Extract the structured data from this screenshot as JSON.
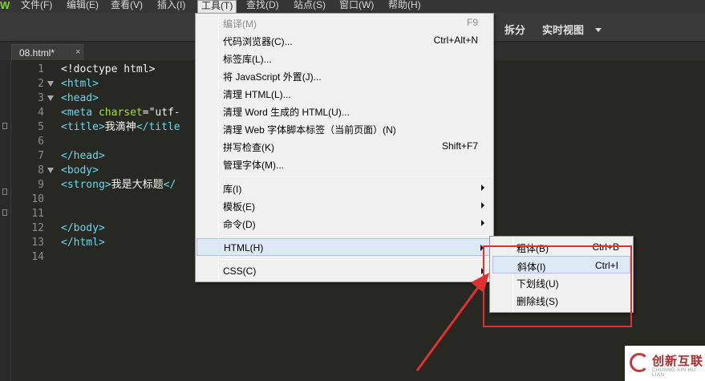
{
  "menubar": {
    "items": [
      {
        "label": "文件(F)"
      },
      {
        "label": "编辑(E)"
      },
      {
        "label": "查看(V)"
      },
      {
        "label": "插入(I)"
      },
      {
        "label": "工具(T)"
      },
      {
        "label": "查找(D)"
      },
      {
        "label": "站点(S)"
      },
      {
        "label": "窗口(W)"
      },
      {
        "label": "帮助(H)"
      }
    ]
  },
  "toolbar": {
    "split_label": "拆分",
    "live_view_label": "实时视图"
  },
  "tabs": [
    {
      "label": "08.html*",
      "close": "×"
    }
  ],
  "editor": {
    "line_numbers": [
      "1",
      "2",
      "3",
      "4",
      "5",
      "6",
      "7",
      "8",
      "9",
      "10",
      "11",
      "12",
      "13",
      "14"
    ],
    "lines": {
      "l1": "<!doctype html>",
      "l2": "<html>",
      "l3": "<head>",
      "l4_tag": "<meta",
      "l4_attr": " charset",
      "l4_rest": "=\"utf-",
      "l5_open": "<title>",
      "l5_text": "我滴神",
      "l5_close": "</title",
      "l7": "</head>",
      "l8": "<body>",
      "l9_open": "<strong>",
      "l9_text": "我是大标题",
      "l9_close": "</",
      "l12": "</body>",
      "l13": "</html>"
    }
  },
  "tools_menu": {
    "items": [
      {
        "label": "编译(M)",
        "shortcut": "F9",
        "disabled": true
      },
      {
        "label": "代码浏览器(C)...",
        "shortcut": "Ctrl+Alt+N"
      },
      {
        "label": "标签库(L)...",
        "shortcut": ""
      },
      {
        "label": "将 JavaScript 外置(J)...",
        "shortcut": ""
      },
      {
        "label": "清理 HTML(L)...",
        "shortcut": ""
      },
      {
        "label": "清理 Word 生成的 HTML(U)...",
        "shortcut": ""
      },
      {
        "label": "清理 Web 字体脚本标签（当前页面）(N)",
        "shortcut": ""
      },
      {
        "label": "拼写检查(K)",
        "shortcut": "Shift+F7"
      },
      {
        "label": "管理字体(M)...",
        "shortcut": ""
      },
      {
        "label": "库(I)",
        "submenu": true
      },
      {
        "label": "模板(E)",
        "submenu": true
      },
      {
        "label": "命令(D)",
        "submenu": true
      },
      {
        "label": "HTML(H)",
        "submenu": true
      },
      {
        "label": "CSS(C)",
        "submenu": true
      }
    ]
  },
  "html_submenu": {
    "items": [
      {
        "label": "粗体(B)",
        "shortcut": "Ctrl+B"
      },
      {
        "label": "斜体(I)",
        "shortcut": "Ctrl+I"
      },
      {
        "label": "下划线(U)",
        "shortcut": ""
      },
      {
        "label": "删除线(S)",
        "shortcut": ""
      }
    ]
  },
  "watermark": {
    "text": "创新互联",
    "sub": "CHUANG XIN HU LIAN"
  },
  "colors": {
    "annotation": "#e03030",
    "tag": "#66d9ef",
    "attr": "#a6e22e",
    "menu_hover": "#dde8f5"
  }
}
